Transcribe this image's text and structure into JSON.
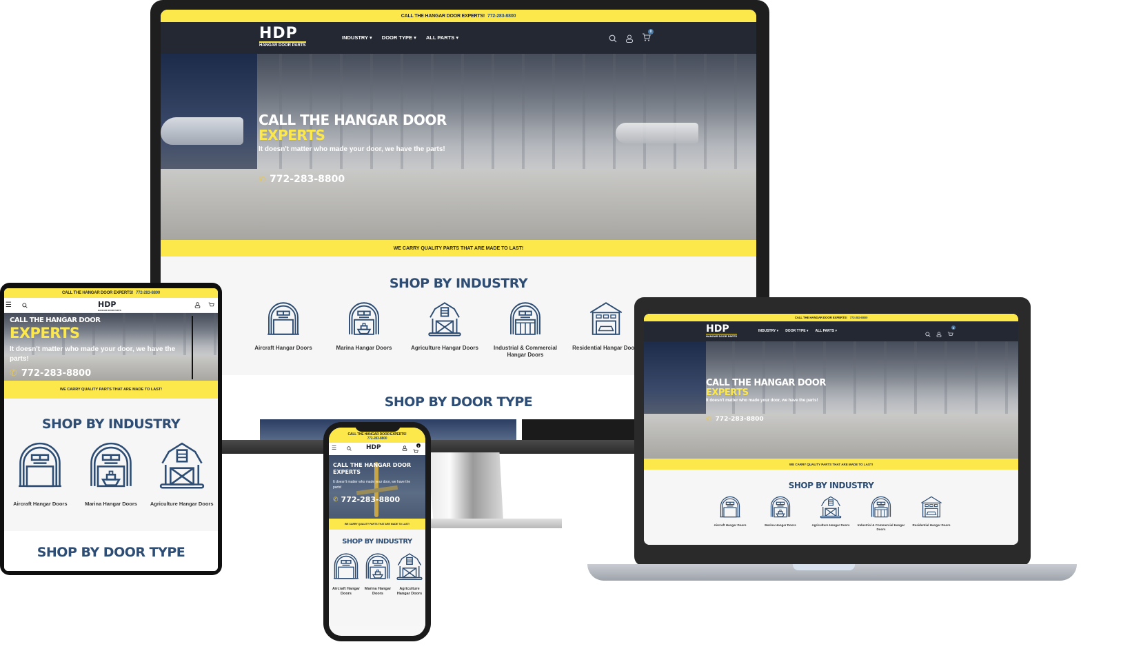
{
  "site": {
    "topbar_text": "CALL THE HANGAR DOOR EXPERTS!",
    "topbar_phone": "772-283-8800",
    "logo_letters": "HDP",
    "logo_subtitle": "HANGAR DOOR PARTS",
    "menu": [
      {
        "label": "INDUSTRY",
        "icon": "caret-down-icon"
      },
      {
        "label": "DOOR TYPE",
        "icon": "caret-down-icon"
      },
      {
        "label": "ALL PARTS",
        "icon": "caret-down-icon"
      }
    ],
    "nav_icons": [
      "search-icon",
      "user-icon",
      "cart-icon"
    ],
    "cart_count": "0",
    "hero": {
      "title_line1": "CALL THE HANGAR DOOR",
      "title_line2": "EXPERTS",
      "tagline": "It doesn't matter who made your door, we have the parts!",
      "phone": "772-283-8800",
      "phone_icon": "phone-icon"
    },
    "strip_text": "WE CARRY QUALITY PARTS THAT ARE MADE TO LAST!",
    "shop_by_industry": {
      "title": "SHOP BY INDUSTRY",
      "items": [
        {
          "label": "Aircraft Hangar Doors",
          "icon": "aircraft-hangar-icon"
        },
        {
          "label": "Marina Hangar Doors",
          "icon": "marina-hangar-icon"
        },
        {
          "label": "Agriculture Hangar Doors",
          "icon": "agriculture-barn-icon"
        },
        {
          "label": "Industrial & Commercial Hangar Doors",
          "icon": "industrial-hangar-icon"
        },
        {
          "label": "Residential Hangar Doors",
          "icon": "residential-garage-icon"
        }
      ]
    },
    "shop_by_door_type": {
      "title": "SHOP BY DOOR TYPE"
    },
    "colors": {
      "accent_yellow": "#fde84b",
      "nav_dark": "#232833",
      "heading_blue": "#2d4d74"
    }
  },
  "mobile": {
    "phone_topbar_line1": "CALL THE HANGAR DOOR EXPERTS!",
    "phone_topbar_line2": "772-283-8800",
    "industry_items": [
      "Aircraft Hangar Doors",
      "Marina Hangar Doors",
      "Agriculture Hangar Doors"
    ],
    "phone_industry_labels": [
      "Aircraft Hangar Doors",
      "Marina Hangar Doors",
      "Agriculture Hangar Doors"
    ]
  }
}
